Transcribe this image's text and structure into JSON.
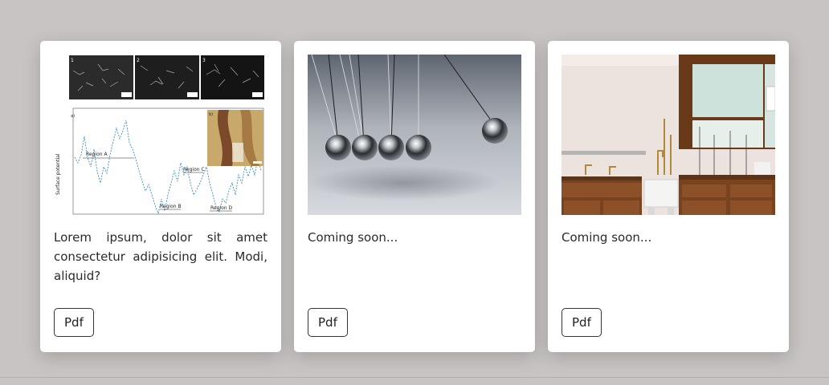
{
  "cards": [
    {
      "image_alt": "surface potential figure with micrographs",
      "description": "Lorem ipsum, dolor sit amet consectetur adipisicing elit. Modi, aliquid?",
      "button_label": "Pdf",
      "figure": {
        "panel_labels": [
          "1",
          "2",
          "3",
          "a)",
          "b)"
        ],
        "axis_label": "Surface potential",
        "regions": [
          "Region A",
          "Region B",
          "Region C",
          "Region D"
        ]
      }
    },
    {
      "image_alt": "Newton's cradle",
      "description": "Coming soon...",
      "button_label": "Pdf"
    },
    {
      "image_alt": "laboratory benches",
      "description": "Coming soon...",
      "button_label": "Pdf"
    }
  ]
}
